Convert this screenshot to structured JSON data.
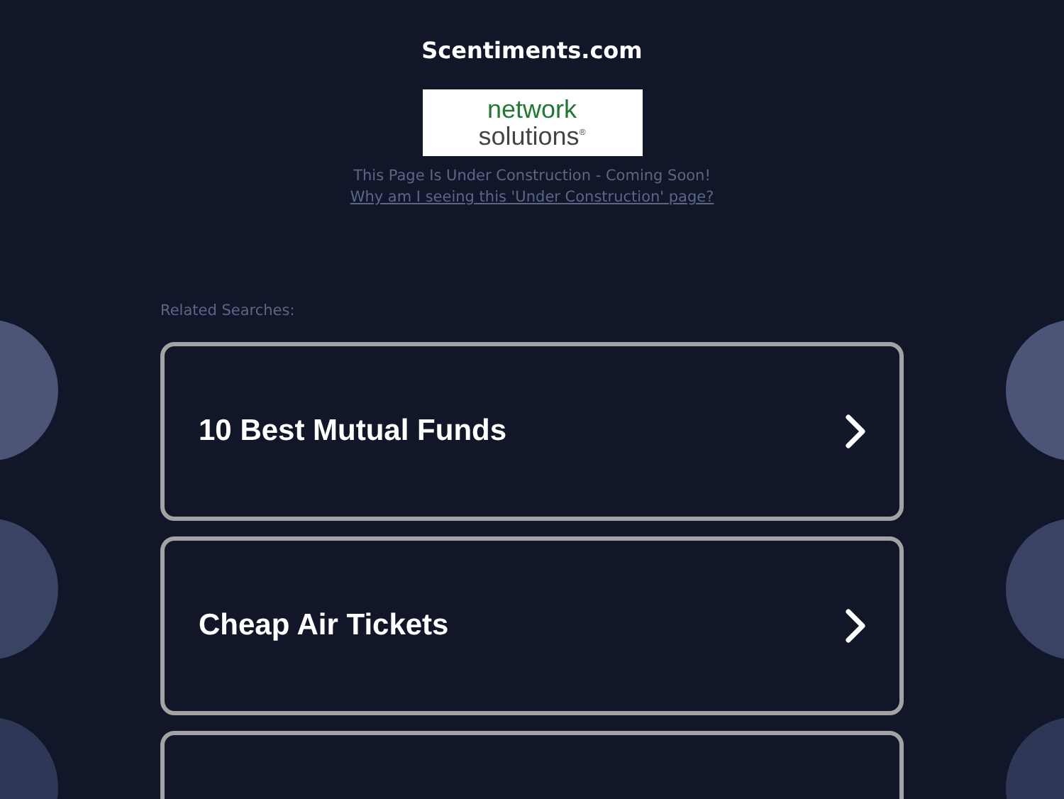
{
  "site_title": "Scentiments.com",
  "logo": {
    "line_1": "network",
    "line_2": "solutions",
    "mark": "®"
  },
  "notice": "This Page Is Under Construction - Coming Soon!",
  "notice_link": "Why am I seeing this 'Under Construction' page?",
  "related_label": "Related Searches:",
  "results": [
    {
      "kind": "search",
      "label": "10 Best Mutual Funds"
    },
    {
      "kind": "search",
      "label": "Cheap Air Tickets"
    },
    {
      "kind": "empty"
    }
  ]
}
